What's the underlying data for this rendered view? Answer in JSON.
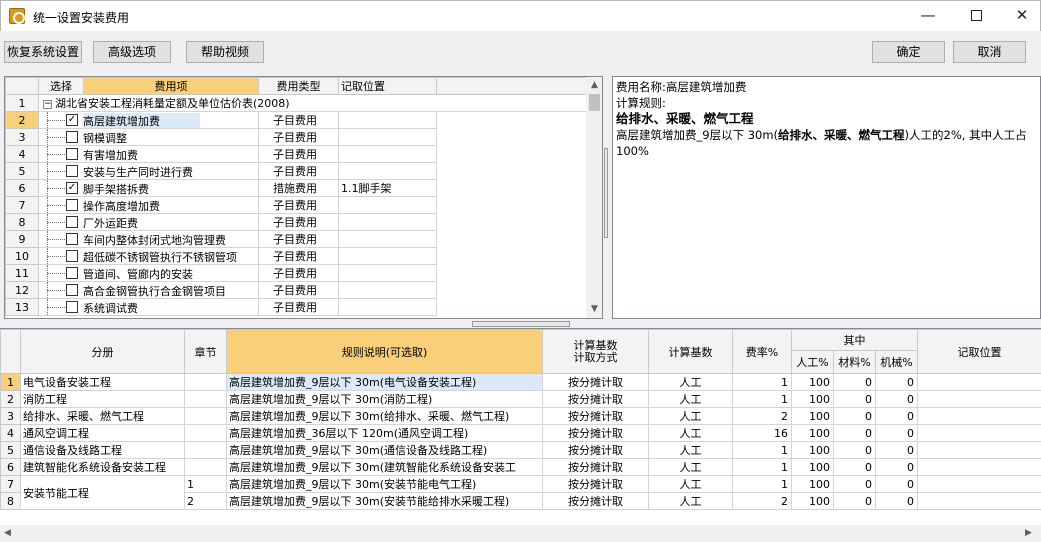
{
  "window": {
    "title": "统一设置安装费用",
    "minimize": "—",
    "close": "✕"
  },
  "toolbar": {
    "restore": "恢复系统设置",
    "advanced": "高级选项",
    "help": "帮助视频",
    "ok": "确定",
    "cancel": "取消"
  },
  "fee_table": {
    "headers": [
      "选择",
      "费用项",
      "费用类型",
      "记取位置"
    ],
    "root": {
      "num": "1",
      "expander": "−",
      "label": "湖北省安装工程消耗量定额及单位估价表(2008)"
    },
    "rows": [
      {
        "num": "2",
        "checked": true,
        "name": "高层建筑增加费",
        "type": "子目费用",
        "pos": ""
      },
      {
        "num": "3",
        "checked": false,
        "name": "钢模调整",
        "type": "子目费用",
        "pos": ""
      },
      {
        "num": "4",
        "checked": false,
        "name": "有害增加费",
        "type": "子目费用",
        "pos": ""
      },
      {
        "num": "5",
        "checked": false,
        "name": "安装与生产同时进行费",
        "type": "子目费用",
        "pos": ""
      },
      {
        "num": "6",
        "checked": true,
        "name": "脚手架搭拆费",
        "type": "措施费用",
        "pos": "1.1脚手架"
      },
      {
        "num": "7",
        "checked": false,
        "name": "操作高度增加费",
        "type": "子目费用",
        "pos": ""
      },
      {
        "num": "8",
        "checked": false,
        "name": "厂外运距费",
        "type": "子目费用",
        "pos": ""
      },
      {
        "num": "9",
        "checked": false,
        "name": "车间内整体封闭式地沟管理费",
        "type": "子目费用",
        "pos": ""
      },
      {
        "num": "10",
        "checked": false,
        "name": "超低碳不锈钢管执行不锈钢管项",
        "type": "子目费用",
        "pos": ""
      },
      {
        "num": "11",
        "checked": false,
        "name": "管道间、管廊内的安装",
        "type": "子目费用",
        "pos": ""
      },
      {
        "num": "12",
        "checked": false,
        "name": "高合金钢管执行合金钢管项目",
        "type": "子目费用",
        "pos": ""
      },
      {
        "num": "13",
        "checked": false,
        "name": "系统调试费",
        "type": "子目费用",
        "pos": ""
      }
    ],
    "check_mark": "✓"
  },
  "description": {
    "name_line": "费用名称:高层建筑增加费",
    "rule_label": "计算规则:",
    "rule_bold": "给排水、采暖、燃气工程",
    "rule_text_1": "高层建筑增加费_9层以下 30m(",
    "rule_text_bold": "给排水、采暖、燃气工程",
    "rule_text_2": ")人工的2%, 其中人工占100%"
  },
  "rule_table": {
    "headers": {
      "category": "分册",
      "chapter": "章节",
      "rule": "规则说明(可选取)",
      "calc_method": "计算基数\n计取方式",
      "calc_base": "计算基数",
      "rate": "费率%",
      "among": "其中",
      "labor": "人工%",
      "material": "材料%",
      "machine": "机械%",
      "position": "记取位置"
    },
    "rows": [
      {
        "num": "1",
        "category": "电气设备安装工程",
        "chapter": "",
        "rule": "高层建筑增加费_9层以下 30m(电气设备安装工程)",
        "method": "按分摊计取",
        "base": "人工",
        "rate": "1",
        "labor": "100",
        "material": "0",
        "machine": "0",
        "position": ""
      },
      {
        "num": "2",
        "category": "消防工程",
        "chapter": "",
        "rule": "高层建筑增加费_9层以下 30m(消防工程)",
        "method": "按分摊计取",
        "base": "人工",
        "rate": "1",
        "labor": "100",
        "material": "0",
        "machine": "0",
        "position": ""
      },
      {
        "num": "3",
        "category": "给排水、采暖、燃气工程",
        "chapter": "",
        "rule": "高层建筑增加费_9层以下 30m(给排水、采暖、燃气工程)",
        "method": "按分摊计取",
        "base": "人工",
        "rate": "2",
        "labor": "100",
        "material": "0",
        "machine": "0",
        "position": ""
      },
      {
        "num": "4",
        "category": "通风空调工程",
        "chapter": "",
        "rule": "高层建筑增加费_36层以下 120m(通风空调工程)",
        "method": "按分摊计取",
        "base": "人工",
        "rate": "16",
        "labor": "100",
        "material": "0",
        "machine": "0",
        "position": ""
      },
      {
        "num": "5",
        "category": "通信设备及线路工程",
        "chapter": "",
        "rule": "高层建筑增加费_9层以下 30m(通信设备及线路工程)",
        "method": "按分摊计取",
        "base": "人工",
        "rate": "1",
        "labor": "100",
        "material": "0",
        "machine": "0",
        "position": ""
      },
      {
        "num": "6",
        "category": "建筑智能化系统设备安装工程",
        "chapter": "",
        "rule": "高层建筑增加费_9层以下 30m(建筑智能化系统设备安装工",
        "method": "按分摊计取",
        "base": "人工",
        "rate": "1",
        "labor": "100",
        "material": "0",
        "machine": "0",
        "position": ""
      },
      {
        "num": "7",
        "category": "安装节能工程",
        "chapter": "1",
        "rule": "高层建筑增加费_9层以下 30m(安装节能电气工程)",
        "method": "按分摊计取",
        "base": "人工",
        "rate": "1",
        "labor": "100",
        "material": "0",
        "machine": "0",
        "position": ""
      },
      {
        "num": "8",
        "category": "",
        "chapter": "2",
        "rule": "高层建筑增加费_9层以下 30m(安装节能给排水采暖工程)",
        "method": "按分摊计取",
        "base": "人工",
        "rate": "2",
        "labor": "100",
        "material": "0",
        "machine": "0",
        "position": ""
      }
    ]
  },
  "scroll": {
    "up": "▲",
    "down": "▼",
    "left": "◀",
    "right": "▶"
  }
}
